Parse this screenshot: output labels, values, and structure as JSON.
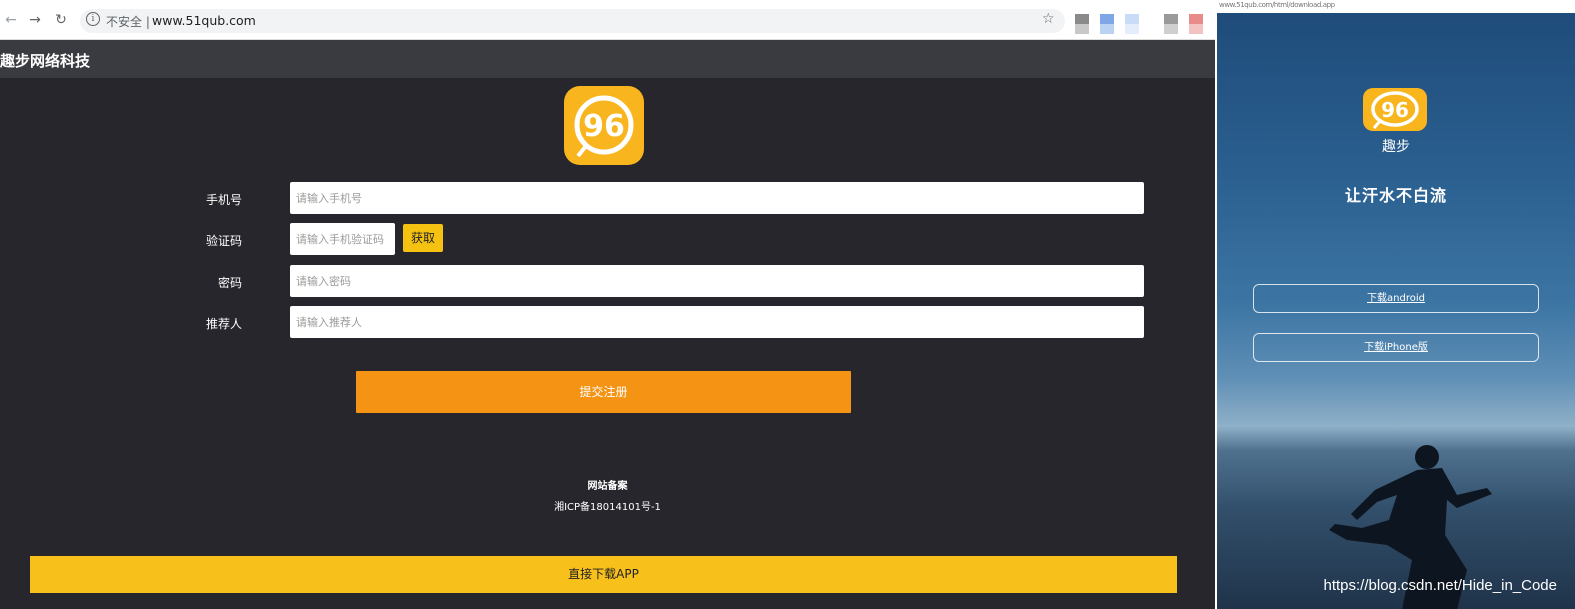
{
  "browser": {
    "security_label": "不安全 |",
    "url": "www.51qub.com"
  },
  "site": {
    "title": "趣步网络科技",
    "logo_text": "96"
  },
  "form": {
    "phone_label": "手机号",
    "phone_placeholder": "请输入手机号",
    "code_label": "验证码",
    "code_placeholder": "请输入手机验证码",
    "get_code_button": "获取",
    "password_label": "密码",
    "password_placeholder": "请输入密码",
    "referrer_label": "推荐人",
    "referrer_placeholder": "请输入推荐人",
    "submit_button": "提交注册"
  },
  "footer": {
    "record_title": "网站备案",
    "record_number": "湘ICP备18014101号-1",
    "download_button": "直接下载APP"
  },
  "phone": {
    "url": "www.51qub.com/html/download.app",
    "brand": "趣步",
    "slogan": "让汗水不白流",
    "button_1": "下载android",
    "button_2": "下载iPhone版",
    "watermark": "https://blog.csdn.net/Hide_in_Code"
  },
  "colors": {
    "page_background": "#26262c",
    "accent_orange": "#f59414",
    "accent_yellow": "#f7c01a",
    "logo_yellow": "#f8b51e"
  }
}
